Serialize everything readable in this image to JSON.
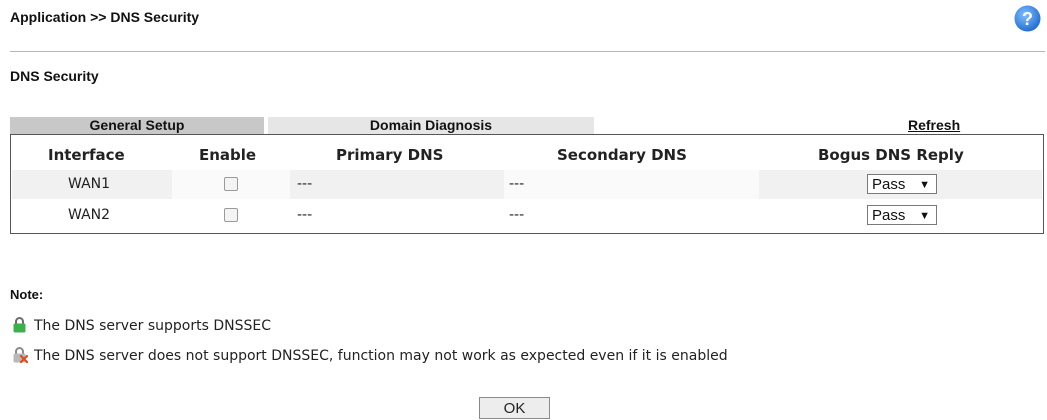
{
  "header": {
    "breadcrumb": "Application >> DNS Security",
    "help_icon": "help-icon"
  },
  "section_title": "DNS Security",
  "tabs": [
    {
      "label": "General Setup",
      "active": true
    },
    {
      "label": "Domain Diagnosis",
      "active": false
    }
  ],
  "refresh_label": "Refresh",
  "table": {
    "columns": [
      "Interface",
      "Enable",
      "Primary DNS",
      "Secondary DNS",
      "Bogus DNS Reply"
    ],
    "rows": [
      {
        "interface": "WAN1",
        "enabled": false,
        "primary_dns": "---",
        "secondary_dns": "---",
        "bogus_reply": "Pass"
      },
      {
        "interface": "WAN2",
        "enabled": false,
        "primary_dns": "---",
        "secondary_dns": "---",
        "bogus_reply": "Pass"
      }
    ]
  },
  "notes": {
    "title": "Note:",
    "items": [
      {
        "icon": "lock-green-icon",
        "text": "The DNS server supports DNSSEC"
      },
      {
        "icon": "lock-gray-x-icon",
        "text": "The DNS server does not support DNSSEC, function may not work as expected even if it is enabled"
      }
    ]
  },
  "ok_label": "OK",
  "colors": {
    "tab_active": "#c8c8c8",
    "tab_inactive": "#e6e6e6",
    "row_even": "#f1f1f1",
    "row_odd": "#ffffff",
    "help_blue": "#2a7be0"
  }
}
